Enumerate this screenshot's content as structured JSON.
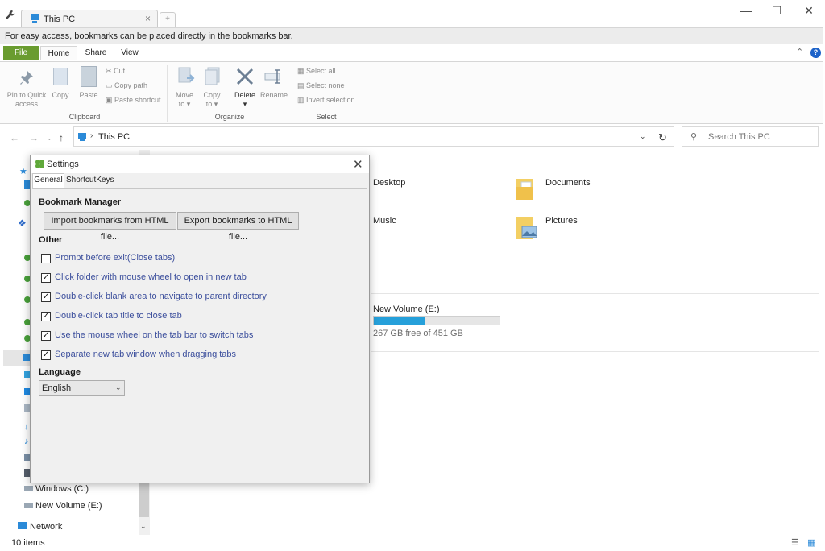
{
  "window": {
    "tab_title": "This PC",
    "tab_close": "×",
    "new_tab": "+",
    "minimize": "—",
    "maximize": "☐",
    "close": "✕"
  },
  "bookmark_bar": {
    "text": "For easy access, bookmarks can be placed directly in the bookmarks bar."
  },
  "ribbon_tabs": {
    "file": "File",
    "home": "Home",
    "share": "Share",
    "view": "View",
    "help": "?"
  },
  "ribbon": {
    "clipboard": {
      "label": "Clipboard",
      "pin_l1": "Pin to Quick",
      "pin_l2": "access",
      "copy": "Copy",
      "paste": "Paste",
      "cut": "Cut",
      "copy_path": "Copy path",
      "paste_shortcut": "Paste shortcut"
    },
    "organize": {
      "label": "Organize",
      "move_l1": "Move",
      "move_l2": "to ▾",
      "copy_l1": "Copy",
      "copy_l2": "to ▾",
      "delete_l1": "Delete",
      "delete_l2": "▾",
      "rename": "Rename"
    },
    "select": {
      "label": "Select",
      "select_all": "Select all",
      "select_none": "Select none",
      "invert": "Invert selection"
    }
  },
  "address": {
    "path": "This PC",
    "search_placeholder": "Search This PC"
  },
  "main": {
    "folders": [
      {
        "label": "Desktop"
      },
      {
        "label": "Documents"
      },
      {
        "label": "Music"
      },
      {
        "label": "Pictures"
      }
    ],
    "drive": {
      "label": "New Volume (E:)",
      "free": "267 GB free of 451 GB",
      "used_fraction": 0.41
    }
  },
  "nav": {
    "windows": "Windows (C:)",
    "newvol": "New Volume (E:)",
    "network": "Network"
  },
  "status": {
    "items": "10 items"
  },
  "settings": {
    "title": "Settings",
    "tab_general": "General",
    "tab_keys": "ShortcutKeys",
    "bookmark_manager": "Bookmark Manager",
    "import_btn": "Import bookmarks from HTML file...",
    "export_btn": "Export bookmarks to HTML file...",
    "other": "Other",
    "options": [
      {
        "label": "Prompt before exit(Close tabs)",
        "checked": false
      },
      {
        "label": "Click folder with mouse wheel to open in new tab",
        "checked": true
      },
      {
        "label": "Double-click blank area to navigate to parent directory",
        "checked": true
      },
      {
        "label": "Double-click tab title to close tab",
        "checked": true
      },
      {
        "label": "Use the mouse wheel on the tab bar to switch tabs",
        "checked": true
      },
      {
        "label": "Separate new tab window when dragging tabs",
        "checked": true
      }
    ],
    "language_title": "Language",
    "language_value": "English"
  }
}
